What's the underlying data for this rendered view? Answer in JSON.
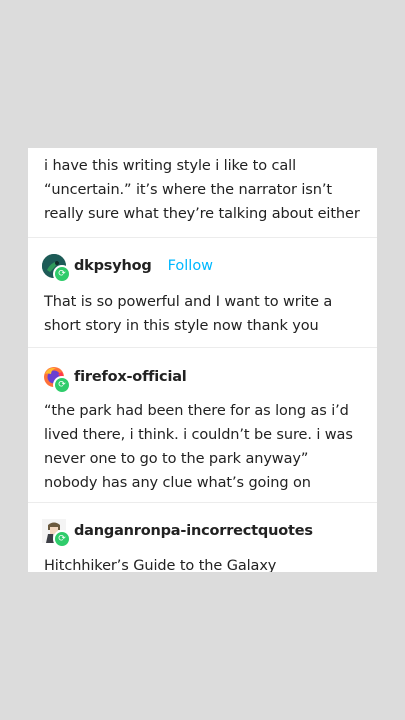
{
  "posts": [
    {
      "text": "i have this writing style i like to call “uncertain.” it’s where the narrator isn’t really sure what they’re talking about either"
    },
    {
      "username": "dkpsyhog",
      "follow_label": "Follow",
      "text": "That is so powerful and I want to write a short story in this style now thank you",
      "avatar_icon": "dkpsyhog-avatar-icon",
      "badge_icon": "reblog-icon"
    },
    {
      "username": "firefox-official",
      "text": "“the park had been there for as long as i’d lived there, i think. i couldn’t be sure. i was never one to go to the park anyway” nobody has any clue what’s going on",
      "avatar_icon": "firefox-logo-icon",
      "badge_icon": "reblog-icon"
    },
    {
      "username": "danganronpa-incorrectquotes",
      "text": "Hitchhiker’s Guide to the Galaxy",
      "avatar_icon": "anime-character-avatar-icon",
      "badge_icon": "reblog-icon"
    }
  ],
  "colors": {
    "background": "#dcdcdc",
    "card": "#ffffff",
    "follow": "#00b8ff",
    "reblog_badge": "#2fcc6b"
  }
}
